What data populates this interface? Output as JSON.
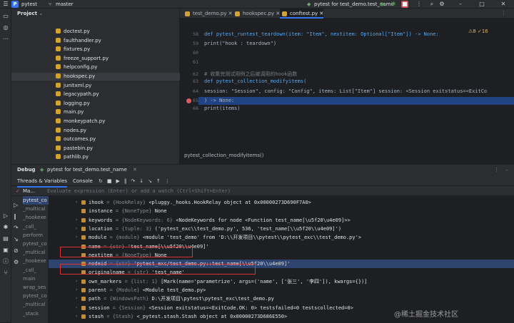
{
  "titlebar": {
    "logo": "P",
    "project": "pytest",
    "branch": "master",
    "run_config": "pytest for test_demo.test_name"
  },
  "project": {
    "header": "Project",
    "files": [
      "doctest.py",
      "faulthandler.py",
      "fixtures.py",
      "freeze_support.py",
      "helpconfig.py",
      "hookspec.py",
      "junitxml.py",
      "legacypath.py",
      "logging.py",
      "main.py",
      "monkeypatch.py",
      "nodes.py",
      "outcomes.py",
      "pastebin.py",
      "pathlib.py"
    ],
    "selected_index": 5
  },
  "editor": {
    "tabs": [
      "test_demo.py",
      "hookspec.py",
      "conftest.py"
    ],
    "active_tab": 2,
    "lines": [
      {
        "num": "58",
        "text": "def pytest_runtest_teardown(item: \"Item\", nextitem: Optional[\"Item\"]) -> None:"
      },
      {
        "num": "59",
        "text": "    print(\"hook : teardown\")"
      },
      {
        "num": "60",
        "text": ""
      },
      {
        "num": "61",
        "text": ""
      },
      {
        "num": "62",
        "text": "# 收集完测试用例之后被调用的hook函数"
      },
      {
        "num": "63",
        "text": "def pytest_collection_modifyitems("
      },
      {
        "num": "64",
        "text": "        session: \"Session\", config: \"Config\", items: List[\"Item\"]   session: <Session  exitstatus=<ExitCo"
      },
      {
        "num": "65",
        "text": ") -> None:"
      },
      {
        "num": "66",
        "text": "    print(items)"
      }
    ],
    "inspections": "⚠8 ✓16",
    "breadcrumb": "pytest_collection_modifyitems()"
  },
  "debug": {
    "title": "Debug",
    "session_tab": "pytest for test_demo.test_name",
    "tabs": [
      "Threads & Variables",
      "Console"
    ],
    "frame_select": "Ma...",
    "eval_placeholder": "Evaluate expression (Enter) or add a watch (Ctrl+Shift+Enter)",
    "frames": [
      "pytest_co",
      "_multical",
      "_hookexe",
      "_call_",
      "perform",
      "pytest_co",
      "_multical",
      "_hookexe",
      "_call_",
      "main",
      "wrap_ses",
      "pytest_co",
      "_multical",
      "_stack"
    ],
    "variables": [
      {
        "name": "ihook",
        "type": "{HookRelay}",
        "value": "<pluggy._hooks.HookRelay object at 0x00000273D690F7A0>",
        "expand": true
      },
      {
        "name": "instance",
        "type": "{NoneType}",
        "value": "None",
        "expand": false
      },
      {
        "name": "keywords",
        "type": "{NodeKeywords: 6}",
        "value": "<NodeKeywords for node <Function test_name[\\u5f20\\u4e09]>>",
        "expand": true
      },
      {
        "name": "location",
        "type": "{tuple: 3}",
        "value": "('pytest_exc\\\\test_demo.py', 536, 'test_name[\\\\u5f20\\\\u4e09]')",
        "expand": true
      },
      {
        "name": "module",
        "type": "{module}",
        "value": "<module 'test_demo' from 'D:\\\\开发项目\\\\pytest\\\\pytest_exc\\\\test_demo.py'>",
        "expand": true
      },
      {
        "name": "name",
        "type": "{str}",
        "value": "'test_name[\\\\u5f20\\\\u4e09]'",
        "expand": false
      },
      {
        "name": "nextitem",
        "type": "{NoneType}",
        "value": "None",
        "expand": false
      },
      {
        "name": "nodeid",
        "type": "{str}",
        "value": "'pytest_exc/test_demo.py::test_name[\\\\u5f20\\\\u4e09]'",
        "expand": false
      },
      {
        "name": "originalname",
        "type": "{str}",
        "value": "'test_name'",
        "expand": false
      },
      {
        "name": "own_markers",
        "type": "{list: 1}",
        "value": "[Mark(name='parametrize', args=('name', ['张三', '李四']), kwargs={})]",
        "expand": true
      },
      {
        "name": "parent",
        "type": "{Module}",
        "value": "<Module test_demo.py>",
        "expand": true
      },
      {
        "name": "path",
        "type": "{WindowsPath}",
        "value": "D:\\开发项目\\pytest\\pytest_exc\\test_demo.py",
        "expand": true
      },
      {
        "name": "session",
        "type": "{Session}",
        "value": "<Session  exitstatus=<ExitCode.OK: 0> testsfailed=0 testscollected=0>",
        "expand": true
      },
      {
        "name": "stash",
        "type": "{Stash}",
        "value": "<_pytest.stash.Stash object at 0x00000273D686E550>",
        "expand": true
      }
    ]
  },
  "watermark": "@稀土掘金技术社区",
  "colors": {
    "accent": "#3574f0",
    "highlight": "#214283",
    "breakpoint": "#db5c5c",
    "annotation": "#e03030"
  }
}
